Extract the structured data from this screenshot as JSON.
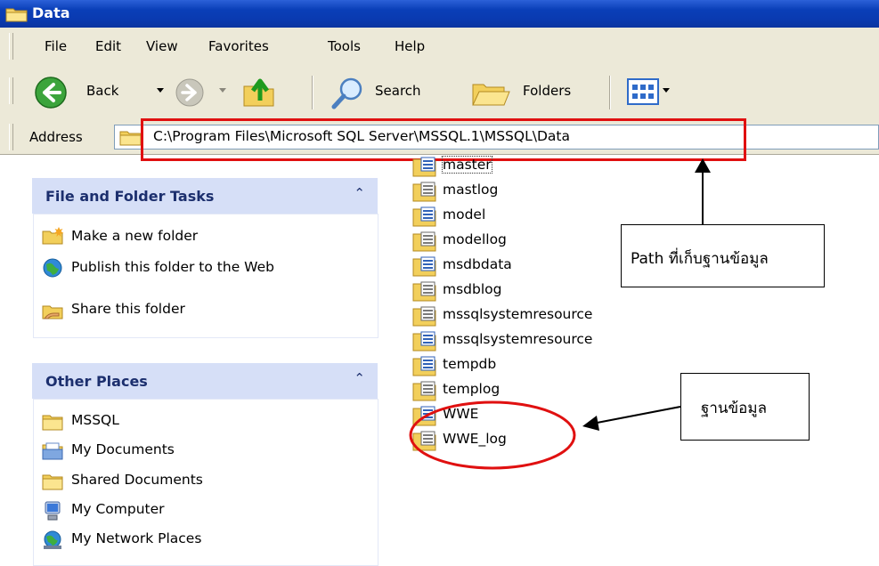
{
  "window": {
    "title": "Data"
  },
  "menu": [
    "File",
    "Edit",
    "View",
    "Favorites",
    "Tools",
    "Help"
  ],
  "toolbar": {
    "back_label": "Back",
    "search_label": "Search",
    "folders_label": "Folders"
  },
  "address": {
    "label": "Address",
    "path": "C:\\Program Files\\Microsoft SQL Server\\MSSQL.1\\MSSQL\\Data"
  },
  "tasks_panel": {
    "title": "File and Folder Tasks",
    "items": [
      {
        "label": "Make a new folder",
        "icon": "new-folder-icon"
      },
      {
        "label": "Publish this folder to the Web",
        "icon": "publish-globe-icon"
      },
      {
        "label": "Share this folder",
        "icon": "share-folder-icon"
      }
    ]
  },
  "places_panel": {
    "title": "Other Places",
    "items": [
      {
        "label": "MSSQL",
        "icon": "folder-icon"
      },
      {
        "label": "My Documents",
        "icon": "my-documents-icon"
      },
      {
        "label": "Shared Documents",
        "icon": "folder-icon"
      },
      {
        "label": "My Computer",
        "icon": "computer-icon"
      },
      {
        "label": "My Network Places",
        "icon": "network-icon"
      }
    ]
  },
  "files": [
    {
      "name": "master",
      "type": "data"
    },
    {
      "name": "mastlog",
      "type": "log"
    },
    {
      "name": "model",
      "type": "data"
    },
    {
      "name": "modellog",
      "type": "log"
    },
    {
      "name": "msdbdata",
      "type": "data"
    },
    {
      "name": "msdblog",
      "type": "log"
    },
    {
      "name": "mssqlsystemresource",
      "type": "log"
    },
    {
      "name": "mssqlsystemresource",
      "type": "data"
    },
    {
      "name": "tempdb",
      "type": "data"
    },
    {
      "name": "templog",
      "type": "log"
    },
    {
      "name": "WWE",
      "type": "data"
    },
    {
      "name": "WWE_log",
      "type": "log"
    }
  ],
  "annotations": {
    "path_callout": "Path ที่เก็บฐานข้อมูล",
    "db_callout": "ฐานข้อมูล"
  },
  "colors": {
    "highlight": "#e01010",
    "titlebar": "#0a3fb8",
    "panel_head": "#d6dff7"
  }
}
